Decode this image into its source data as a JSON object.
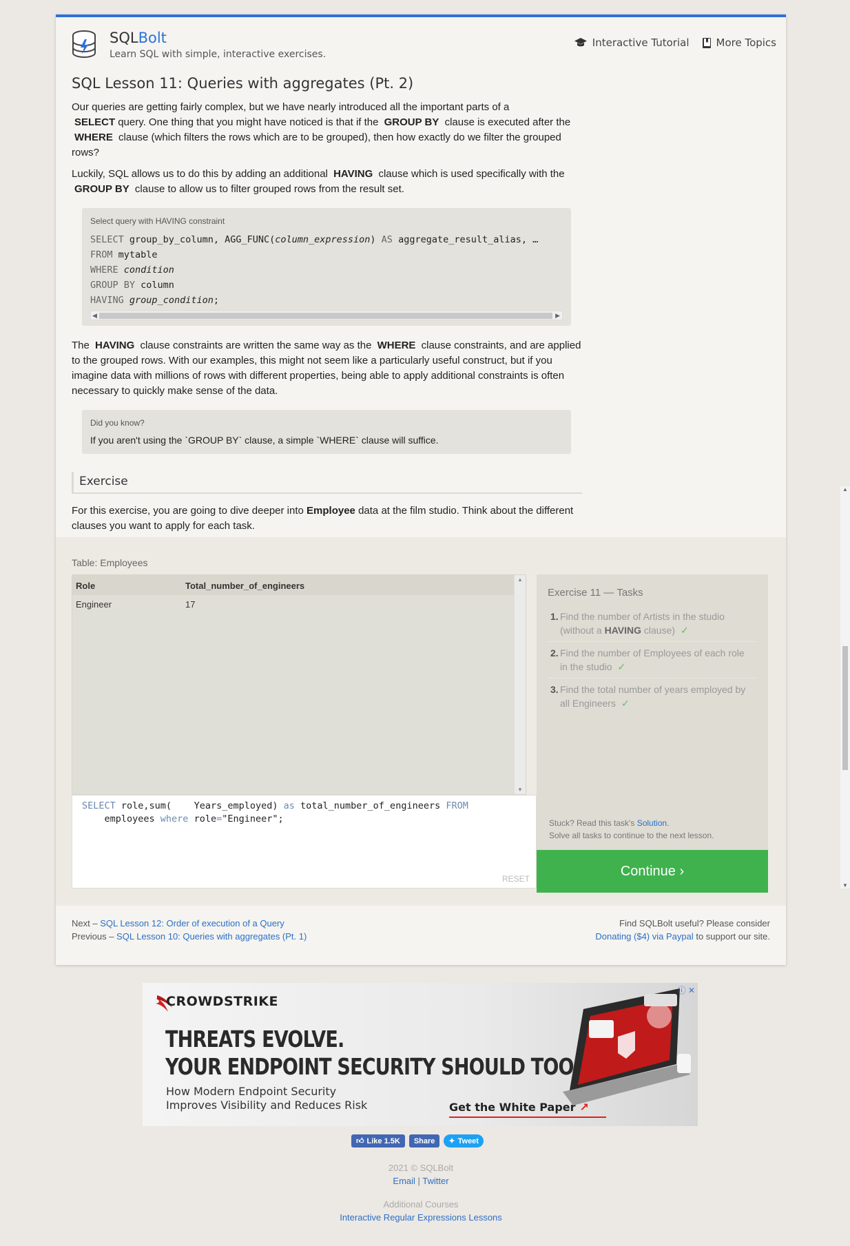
{
  "header": {
    "brand_sql": "SQL",
    "brand_bolt": "Bolt",
    "tagline": "Learn SQL with simple, interactive exercises.",
    "nav": [
      {
        "label": "Interactive Tutorial",
        "icon": "graduation-cap-icon"
      },
      {
        "label": "More Topics",
        "icon": "book-icon"
      }
    ]
  },
  "lesson": {
    "title": "SQL Lesson 11: Queries with aggregates (Pt. 2)",
    "p1_a": "Our queries are getting fairly complex, but we have nearly introduced all the important parts of a",
    "p1_kw1": "SELECT",
    "p1_b": "query. One thing that you might have noticed is that if the",
    "p1_kw2": "GROUP BY",
    "p1_c": "clause is executed after the",
    "p1_kw3": "WHERE",
    "p1_d": "clause (which filters the rows which are to be grouped), then how exactly do we filter the grouped rows?",
    "p2_a": "Luckily, SQL allows us to do this by adding an additional",
    "p2_kw1": "HAVING",
    "p2_b": "clause which is used specifically with the",
    "p2_kw2": "GROUP BY",
    "p2_c": "clause to allow us to filter grouped rows from the result set.",
    "code_caption": "Select query with HAVING constraint",
    "code": {
      "l1_kw": "SELECT",
      "l1_a": " group_by_column, AGG_FUNC(",
      "l1_it": "column_expression",
      "l1_b": ") ",
      "l1_kw2": "AS",
      "l1_c": " aggregate_result_alias, …",
      "l2_kw": "FROM",
      "l2_a": " mytable",
      "l3_kw": "WHERE",
      "l3_it": "condition",
      "l4_kw": "GROUP BY",
      "l4_a": " column",
      "l5_kw": "HAVING",
      "l5_it": "group_condition",
      "l5_end": ";"
    },
    "p3_a": "The",
    "p3_kw1": "HAVING",
    "p3_b": "clause constraints are written the same way as the",
    "p3_kw2": "WHERE",
    "p3_c": "clause constraints, and are applied to the grouped rows. With our examples, this might not seem like a particularly useful construct, but if you imagine data with millions of rows with different properties, being able to apply additional constraints is often necessary to quickly make sense of the data.",
    "did_you_know_caption": "Did you know?",
    "did_you_know_text": "If you aren't using the `GROUP BY` clause, a simple `WHERE` clause will suffice.",
    "exercise_heading": "Exercise",
    "exercise_a": "For this exercise, you are going to dive deeper into",
    "exercise_kw": "Employee",
    "exercise_b": "data at the film studio. Think about the different clauses you want to apply for each task."
  },
  "exercise": {
    "table_caption": "Table: Employees",
    "columns": [
      "Role",
      "Total_number_of_engineers"
    ],
    "rows": [
      [
        "Engineer",
        "17"
      ]
    ],
    "editor": {
      "kw1": "SELECT",
      "t1": " role,sum(    Years_employed) ",
      "kw2": "as",
      "t2": " total_number_of_engineers ",
      "kw3": "FROM",
      "t3": "    employees ",
      "kw4": "where",
      "t4": " role",
      "kw5": "=",
      "t5": "\"Engineer\";"
    },
    "reset_label": "RESET",
    "tasks_title": "Exercise 11 — Tasks",
    "tasks": [
      {
        "num": "1.",
        "text_a": "Find the number of Artists in the studio (without a ",
        "bold": "HAVING",
        "text_b": " clause)",
        "check": "✓"
      },
      {
        "num": "2.",
        "text_a": "Find the number of Employees of each role in the studio",
        "bold": "",
        "text_b": "",
        "check": "✓"
      },
      {
        "num": "3.",
        "text_a": "Find the total number of years employed by all Engineers",
        "bold": "",
        "text_b": "",
        "check": "✓"
      }
    ],
    "stuck_a": "Stuck? Read this task's ",
    "stuck_link": "Solution",
    "stuck_b": ".",
    "solve_all": "Solve all tasks to continue to the next lesson.",
    "continue_label": "Continue ›"
  },
  "footer_nav": {
    "next_prefix": "Next – ",
    "next_link": "SQL Lesson 12: Order of execution of a Query",
    "prev_prefix": "Previous – ",
    "prev_link": "SQL Lesson 10: Queries with aggregates (Pt. 1)",
    "support_text": "Find SQLBolt useful? Please consider",
    "support_link": "Donating ($4) via Paypal",
    "support_suffix": " to support our site."
  },
  "ad": {
    "brand": "CROWDSTRIKE",
    "headline_1": "THREATS EVOLVE.",
    "headline_2": "YOUR ENDPOINT SECURITY SHOULD TOO.",
    "sub_1": "How Modern Endpoint Security",
    "sub_2": "Improves Visibility and Reduces Risk",
    "cta": "Get the White Paper"
  },
  "social": {
    "like": "Like 1.5K",
    "share": "Share",
    "tweet": "Tweet"
  },
  "bottom": {
    "copyright": "2021 © SQLBolt",
    "email": "Email",
    "sep": " | ",
    "twitter": "Twitter",
    "additional": "Additional Courses",
    "regex_link": "Interactive Regular Expressions Lessons"
  },
  "colors": {
    "accent": "#2d72d9",
    "continue": "#3fb24d",
    "page_bg": "#ece8e4"
  }
}
